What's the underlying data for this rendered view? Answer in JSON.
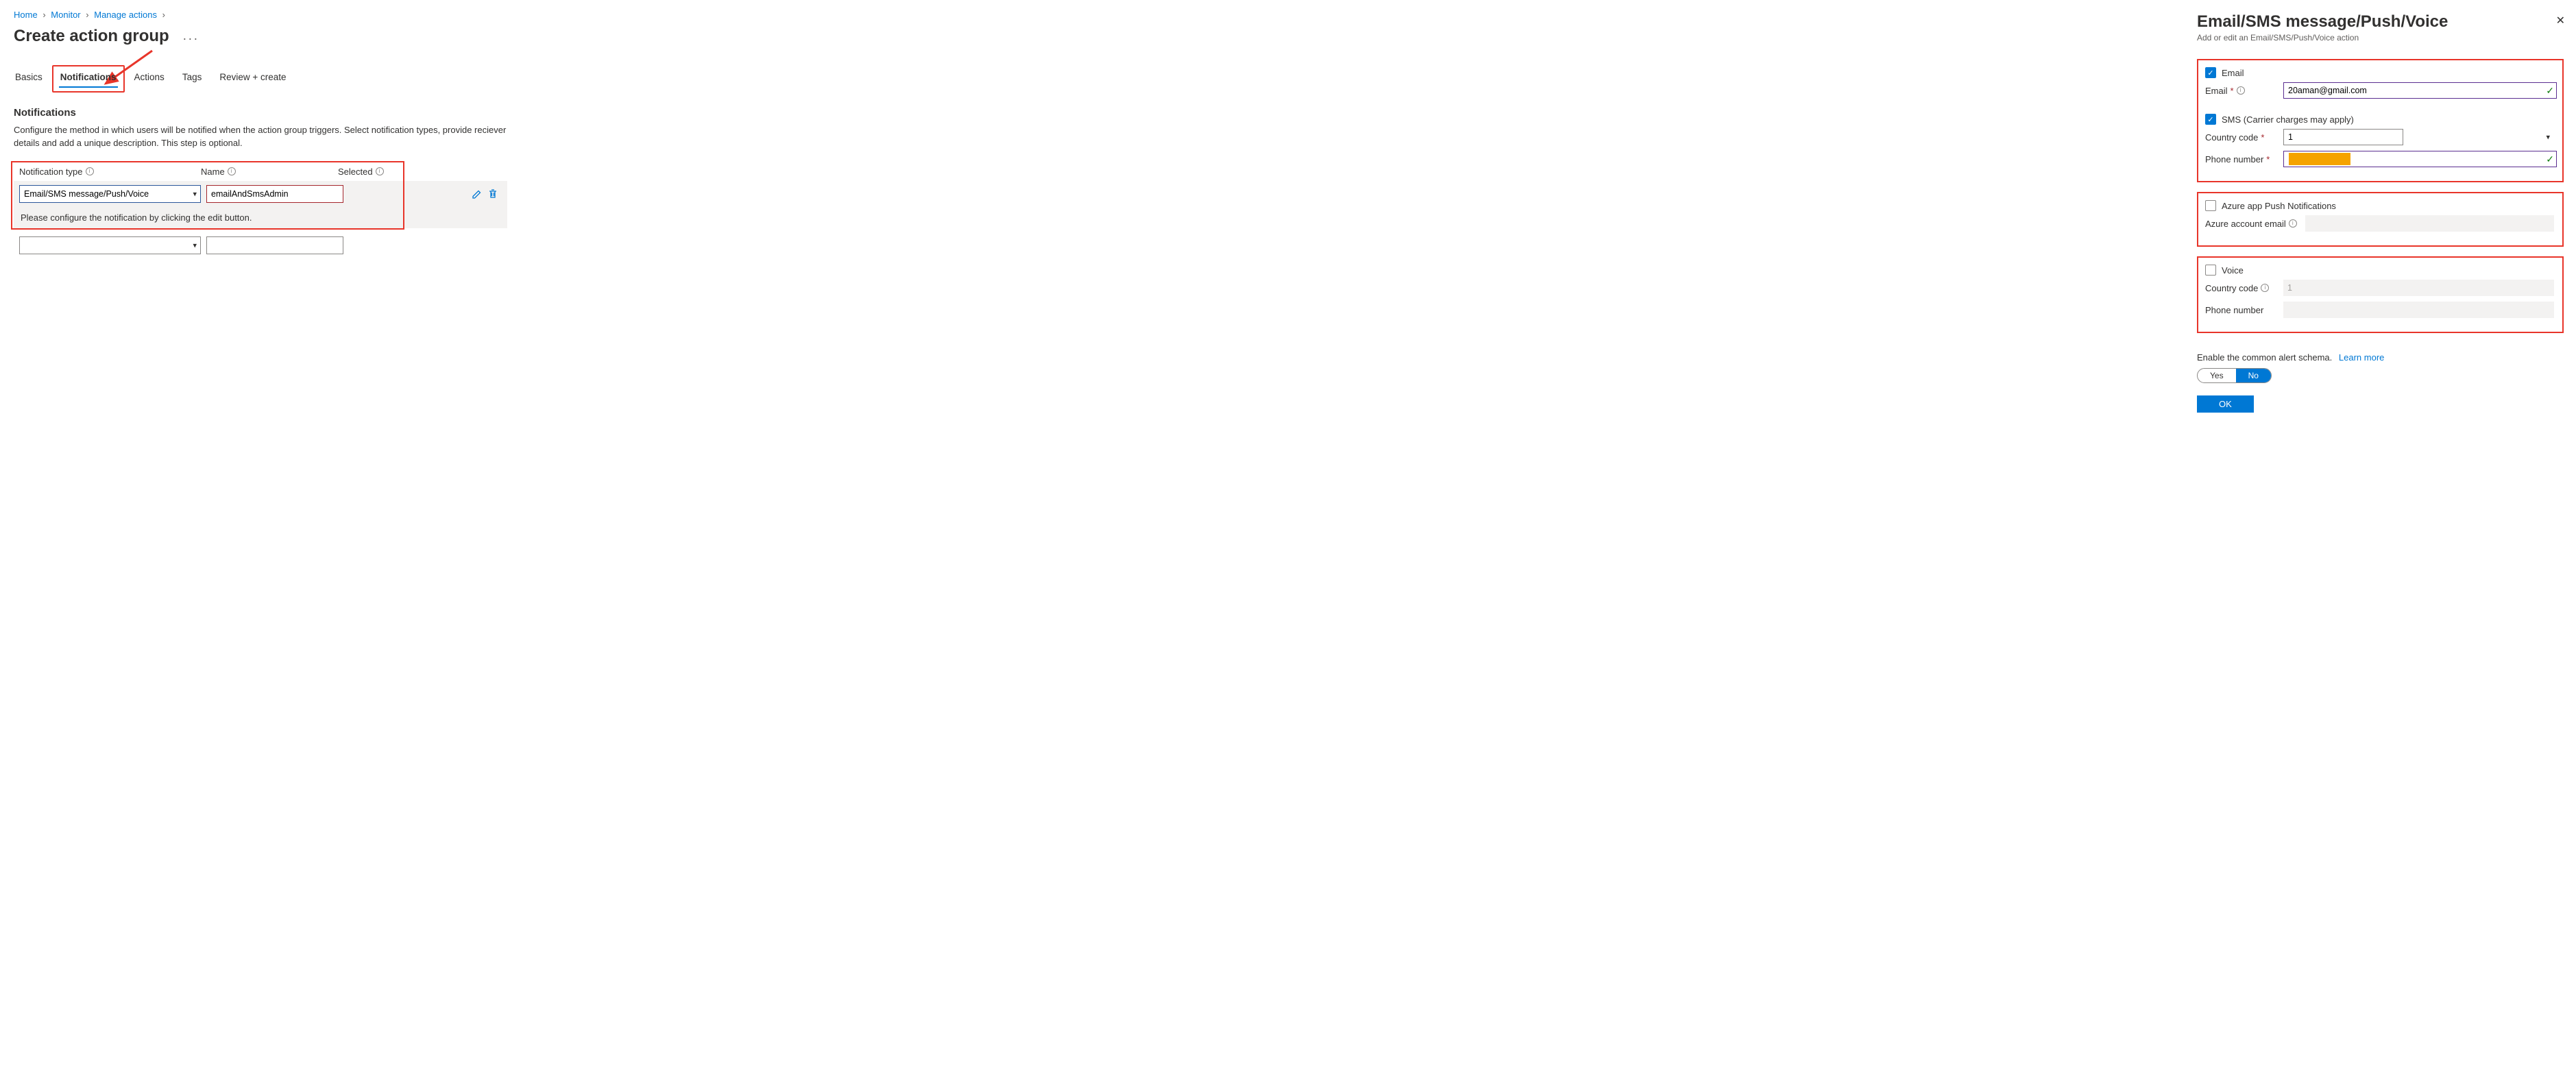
{
  "breadcrumb": {
    "home": "Home",
    "monitor": "Monitor",
    "manage_actions": "Manage actions"
  },
  "page": {
    "title": "Create action group"
  },
  "tabs": {
    "basics": "Basics",
    "notifications": "Notifications",
    "actions": "Actions",
    "tags": "Tags",
    "review": "Review + create"
  },
  "notifications": {
    "heading": "Notifications",
    "description": "Configure the method in which users will be notified when the action group triggers. Select notification types, provide reciever details and add a unique description. This step is optional.",
    "columns": {
      "type": "Notification type",
      "name": "Name",
      "selected": "Selected"
    },
    "row1": {
      "type_value": "Email/SMS message/Push/Voice",
      "name_value": "emailAndSmsAdmin"
    },
    "hint": "Please configure the notification by clicking the edit button."
  },
  "panel": {
    "title": "Email/SMS message/Push/Voice",
    "subtitle": "Add or edit an Email/SMS/Push/Voice action",
    "email": {
      "check_label": "Email",
      "field_label": "Email",
      "value": "20aman@gmail.com"
    },
    "sms": {
      "check_label": "SMS (Carrier charges may apply)",
      "country_label": "Country code",
      "country_value": "1",
      "phone_label": "Phone number"
    },
    "push": {
      "check_label": "Azure app Push Notifications",
      "account_label": "Azure account email"
    },
    "voice": {
      "check_label": "Voice",
      "country_label": "Country code",
      "country_value": "1",
      "phone_label": "Phone number"
    },
    "schema": {
      "text": "Enable the common alert schema.",
      "learn": "Learn more",
      "yes": "Yes",
      "no": "No"
    },
    "ok": "OK"
  }
}
